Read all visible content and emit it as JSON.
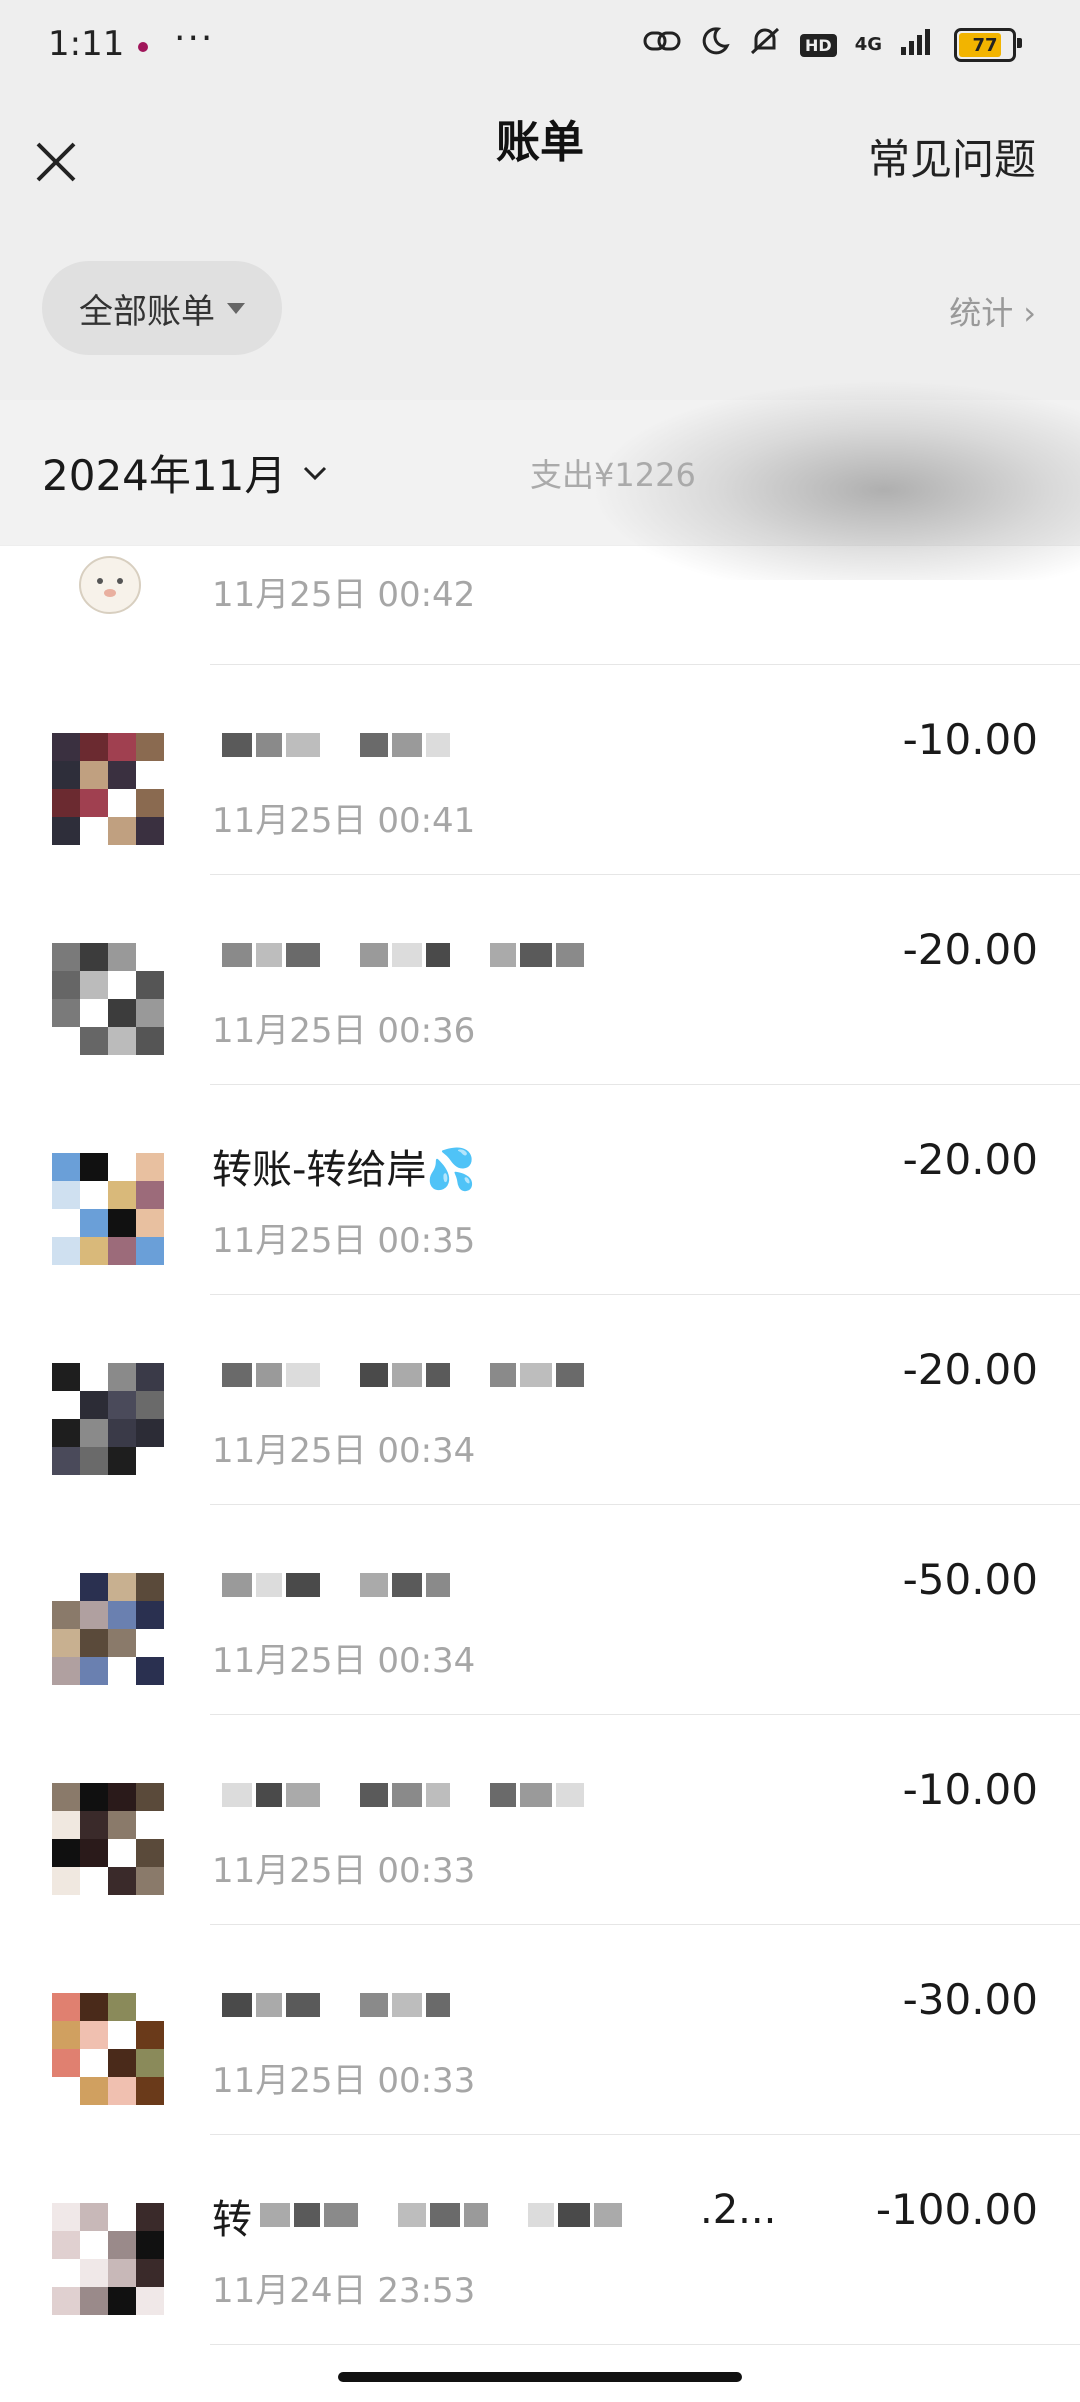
{
  "status": {
    "time": "1:11",
    "more": "···",
    "hd": "HD",
    "network": "4G",
    "battery": "77"
  },
  "header": {
    "title": "账单",
    "faq": "常见问题",
    "filter": "全部账单",
    "stats": "统计",
    "stats_chevron": "›"
  },
  "month": {
    "label": "2024年11月",
    "expense_label": "支出¥1226"
  },
  "first_entry": {
    "time": "11月25日 00:42"
  },
  "entries": [
    {
      "title": "",
      "time": "11月25日 00:41",
      "amount": "-10.00"
    },
    {
      "title": "",
      "time": "11月25日 00:36",
      "amount": "-20.00"
    },
    {
      "title": "转账-转给岸💦",
      "time": "11月25日 00:35",
      "amount": "-20.00"
    },
    {
      "title": "",
      "time": "11月25日 00:34",
      "amount": "-20.00"
    },
    {
      "title": "",
      "time": "11月25日 00:34",
      "amount": "-50.00"
    },
    {
      "title": "",
      "time": "11月25日 00:33",
      "amount": "-10.00"
    },
    {
      "title": "",
      "time": "11月25日 00:33",
      "amount": "-30.00"
    },
    {
      "title": "转",
      "title_suffix": ".2...",
      "time": "11月24日 23:53",
      "amount": "-100.00"
    }
  ],
  "icons": {
    "close": "close-icon",
    "dropdown": "caret-down-icon",
    "month_chevron": "chevron-down-icon"
  },
  "colors": {
    "header_bg": "#eeeeee",
    "battery": "#f2b400",
    "muted_text": "#a6a6a6"
  }
}
